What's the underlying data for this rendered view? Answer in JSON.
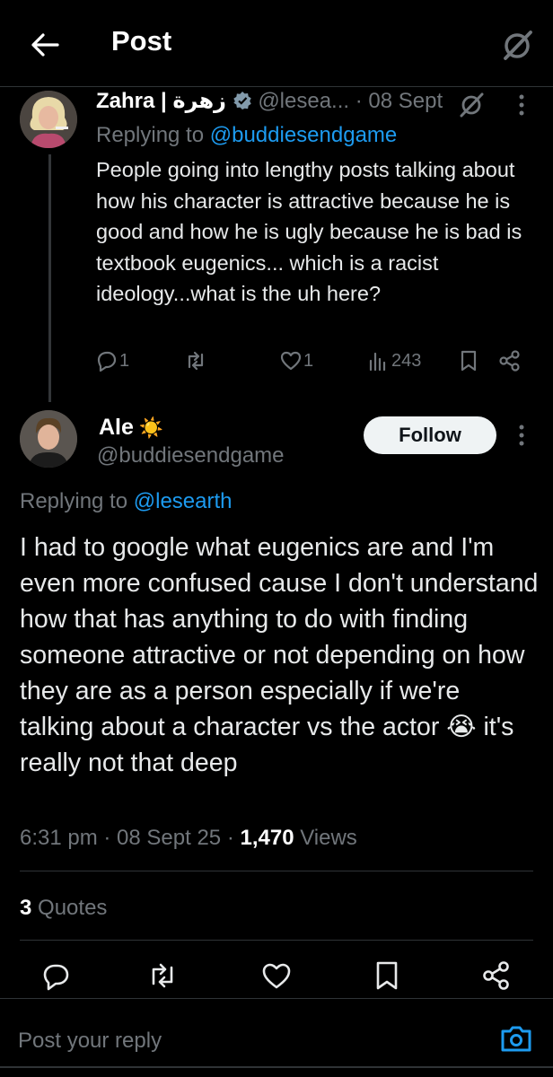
{
  "header": {
    "title": "Post"
  },
  "parent": {
    "name": "Zahra | زهرة",
    "handle": "@lesea...",
    "date": "· 08 Sept",
    "replying_prefix": "Replying to",
    "replying_handle": "@buddiesendgame",
    "text": "People going into lengthy posts talking about how his character is attractive because he is good and how he is ugly because he is bad is textbook eugenics... which is a racist ideology...what is the uh here?",
    "replies": "1",
    "likes": "1",
    "views": "243"
  },
  "main": {
    "name": "Ale",
    "name_emoji": "☀️",
    "handle": "@buddiesendgame",
    "follow_label": "Follow",
    "replying_prefix": "Replying to",
    "replying_handle": "@lesearth",
    "text": "I had to google what eugenics are and I'm even more confused cause I don't understand how that has anything to do with finding someone attractive or not depending on how they are as a person especially if we're talking about a character vs the actor 😭 it's really not that deep",
    "time": "6:31 pm · 08 Sept 25 ·",
    "views_count": "1,470",
    "views_label": "Views",
    "quotes_count": "3",
    "quotes_label": "Quotes"
  },
  "composer": {
    "placeholder": "Post your reply"
  },
  "colors": {
    "background": "#000000",
    "accent": "#1d9bf0",
    "muted": "#71767b",
    "text": "#e7e9ea",
    "divider": "#2f3336"
  },
  "icons": [
    "back-arrow-icon",
    "grok-icon",
    "more-icon",
    "reply-icon",
    "repost-icon",
    "like-icon",
    "views-icon",
    "bookmark-icon",
    "share-icon",
    "verified-icon",
    "camera-icon"
  ]
}
